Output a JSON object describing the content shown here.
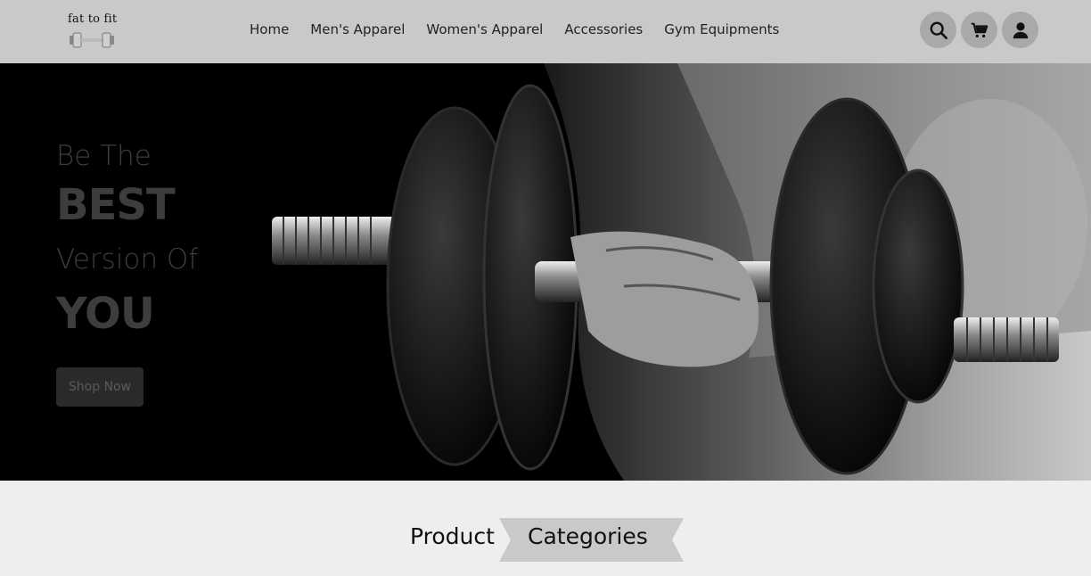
{
  "logo": {
    "text": "fat to fit"
  },
  "nav": {
    "links": [
      "Home",
      "Men's Apparel",
      "Women's Apparel",
      "Accessories",
      "Gym Equipments"
    ]
  },
  "icons": {
    "search": "search-icon",
    "cart": "cart-icon",
    "account": "user-icon"
  },
  "hero": {
    "line1": "Be The",
    "line2": "BEST",
    "line3": "Version Of",
    "line4": "YOU",
    "cta_label": "Shop Now"
  },
  "section": {
    "title_word1": "Product",
    "title_word2": "Categories"
  },
  "colors": {
    "navbar_bg": "#c9c9c9",
    "icon_bg": "#a9a9a9",
    "hero_bg": "#000000",
    "page_bg": "#eeeeee",
    "ribbon": "#c9c9c9"
  }
}
